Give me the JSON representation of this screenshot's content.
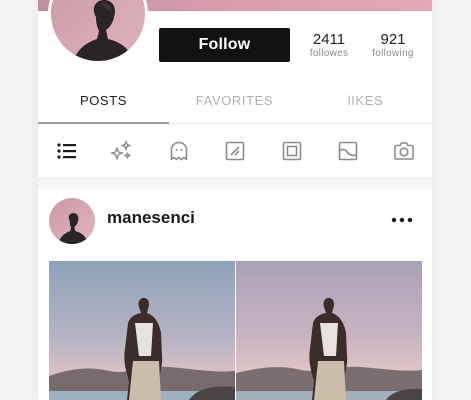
{
  "profile": {
    "follow_label": "Follow",
    "stats": [
      {
        "value": "2411",
        "label": "followes"
      },
      {
        "value": "921",
        "label": "following"
      }
    ]
  },
  "tabs": [
    {
      "label": "POSTS",
      "active": true
    },
    {
      "label": "FAVORITES",
      "active": false
    },
    {
      "label": "lIKES",
      "active": false
    }
  ],
  "filter_icons": [
    "list-icon",
    "sparkles-icon",
    "ghost-icon",
    "note-icon",
    "square-icon",
    "image-icon",
    "camera-icon"
  ],
  "post": {
    "username": "manesenci",
    "menu_icon": "more-horizontal-icon",
    "photo_count": 2
  },
  "colors": {
    "banner": "#d89cad",
    "button": "#121212",
    "active_tab": "#1d1d1d",
    "inactive_tab": "#b0b0b0"
  }
}
